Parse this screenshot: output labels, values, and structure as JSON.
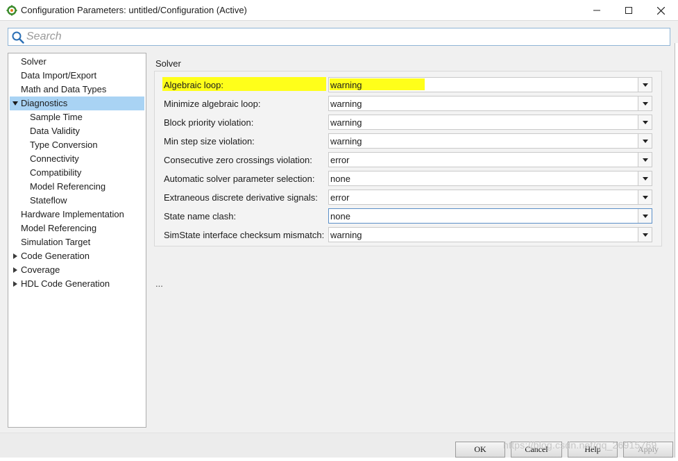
{
  "window": {
    "title": "Configuration Parameters: untitled/Configuration (Active)",
    "icon": "matlab-gear-icon",
    "controls": [
      "minimize",
      "maximize",
      "close"
    ]
  },
  "search": {
    "placeholder": "Search",
    "value": ""
  },
  "tree": {
    "items": [
      {
        "label": "Solver",
        "level": 0,
        "expander": "none"
      },
      {
        "label": "Data Import/Export",
        "level": 0,
        "expander": "none"
      },
      {
        "label": "Math and Data Types",
        "level": 0,
        "expander": "none"
      },
      {
        "label": "Diagnostics",
        "level": 0,
        "expander": "expanded",
        "selected": true
      },
      {
        "label": "Sample Time",
        "level": 1,
        "expander": "none"
      },
      {
        "label": "Data Validity",
        "level": 1,
        "expander": "none"
      },
      {
        "label": "Type Conversion",
        "level": 1,
        "expander": "none"
      },
      {
        "label": "Connectivity",
        "level": 1,
        "expander": "none"
      },
      {
        "label": "Compatibility",
        "level": 1,
        "expander": "none"
      },
      {
        "label": "Model Referencing",
        "level": 1,
        "expander": "none"
      },
      {
        "label": "Stateflow",
        "level": 1,
        "expander": "none"
      },
      {
        "label": "Hardware Implementation",
        "level": 0,
        "expander": "none"
      },
      {
        "label": "Model Referencing",
        "level": 0,
        "expander": "none"
      },
      {
        "label": "Simulation Target",
        "level": 0,
        "expander": "none"
      },
      {
        "label": "Code Generation",
        "level": 0,
        "expander": "collapsed"
      },
      {
        "label": "Coverage",
        "level": 0,
        "expander": "collapsed"
      },
      {
        "label": "HDL Code Generation",
        "level": 0,
        "expander": "collapsed"
      }
    ]
  },
  "panel": {
    "section_title": "Solver",
    "rows": [
      {
        "label": "Algebraic loop:",
        "value": "warning",
        "highlighted": true
      },
      {
        "label": "Minimize algebraic loop:",
        "value": "warning"
      },
      {
        "label": "Block priority violation:",
        "value": "warning"
      },
      {
        "label": "Min step size violation:",
        "value": "warning"
      },
      {
        "label": "Consecutive zero crossings violation:",
        "value": "error"
      },
      {
        "label": "Automatic solver parameter selection:",
        "value": "none"
      },
      {
        "label": "Extraneous discrete derivative signals:",
        "value": "error"
      },
      {
        "label": "State name clash:",
        "value": "none",
        "focused": true
      },
      {
        "label": "SimState interface checksum mismatch:",
        "value": "warning"
      }
    ],
    "more_text": "..."
  },
  "buttons": {
    "ok": "OK",
    "cancel": "Cancel",
    "help": "Help",
    "apply": "Apply"
  },
  "watermark": "https://blog.csdn.net/qq_26915769",
  "colors": {
    "highlight": "#ffff1a",
    "selection": "#a9d3f4",
    "focus_border": "#5a8fc8"
  }
}
